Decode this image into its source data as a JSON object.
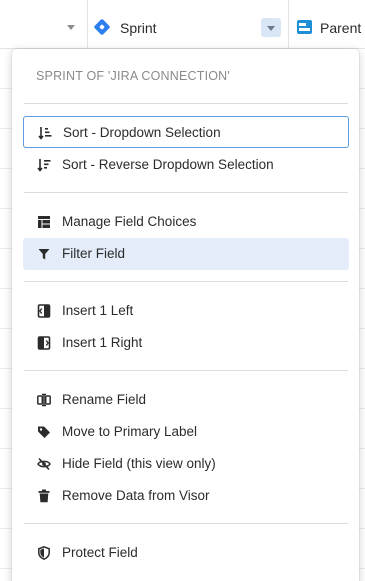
{
  "header": {
    "sprint_column_label": "Sprint",
    "parent_column_label": "Parent"
  },
  "menu": {
    "title": "SPRINT OF 'JIRA CONNECTION'",
    "items": [
      {
        "label": "Sort - Dropdown Selection",
        "icon": "sort-ascending-icon"
      },
      {
        "label": "Sort - Reverse Dropdown Selection",
        "icon": "sort-descending-icon"
      },
      {
        "label": "Manage Field Choices",
        "icon": "table-icon"
      },
      {
        "label": "Filter Field",
        "icon": "filter-icon"
      },
      {
        "label": "Insert 1 Left",
        "icon": "insert-left-icon"
      },
      {
        "label": "Insert 1 Right",
        "icon": "insert-right-icon"
      },
      {
        "label": "Rename Field",
        "icon": "text-cursor-icon"
      },
      {
        "label": "Move to Primary Label",
        "icon": "tag-icon"
      },
      {
        "label": "Hide Field (this view only)",
        "icon": "eye-slash-icon"
      },
      {
        "label": "Remove Data from Visor",
        "icon": "trash-icon"
      },
      {
        "label": "Protect Field",
        "icon": "shield-icon"
      }
    ]
  },
  "colors": {
    "sprint_icon": "#2d7ff0",
    "parent_icon": "#1e8fd6",
    "focus_border": "#5d9bd9",
    "active_bg": "#e3ecf8",
    "dropdown_button_bg": "#d9e6f5"
  }
}
